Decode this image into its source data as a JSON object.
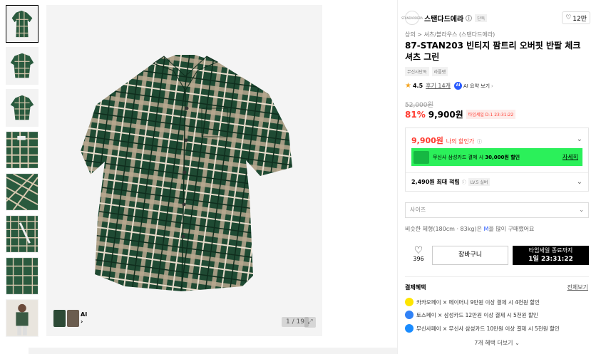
{
  "thumbnails": {
    "count": 8,
    "active_index": 0
  },
  "main_image": {
    "counter": "1 / 19",
    "ai_chip_label": "AI",
    "ai_chip_chevron": "›"
  },
  "brand": {
    "logo_text": "STANDARDERA",
    "name": "스탠다드에라",
    "tag": "단독",
    "likes": "12만"
  },
  "breadcrumb": "상의 > 셔츠/블라우스 (스탠다드에라)",
  "product": {
    "title": "87-STAN203 빈티지 팜트리 오버핏 반팔 체크 셔츠 그린",
    "tags": [
      "무신사단독",
      "라플렛"
    ],
    "rating": "4.5",
    "review_link": "후기 14개",
    "ai_summary": "AI 요약 보기"
  },
  "pricing": {
    "original": "52,000원",
    "discount": "81%",
    "price": "9,900원",
    "timesale": "타임세일 D-1 23:31:22"
  },
  "benefit_box": {
    "my_price": "9,900원",
    "my_price_label": "나의 할인가",
    "promo_text_pre": "무신사 삼성카드 결제 시 ",
    "promo_text_bold": "30,000원 할인",
    "promo_detail": "자세히",
    "points": "2,490원 최대 적립",
    "level": "LV.5 실버"
  },
  "size": {
    "placeholder": "사이즈",
    "note_pre": "비슷한 체형(180cm · 83kg)은 ",
    "note_size": "M",
    "note_post": "을 많이 구매했어요"
  },
  "actions": {
    "like_count": "396",
    "cart": "장바구니",
    "buy_line1": "타임세일 종료까지",
    "buy_line2": "1일 23:31:22"
  },
  "payment": {
    "title": "결제혜택",
    "view_all": "전체보기",
    "items": [
      {
        "text": "카카오페이 × 페이머니 9만원 이상 결제 시 4천원 할인",
        "color": "#fee500"
      },
      {
        "text": "토스페이 × 삼성카드 12만원 이상 결제 시 5천원 할인",
        "color": "#3182f6"
      },
      {
        "text": "무신사페이 × 무신사 삼성카드 10만원 이상 결제 시 5천원 할인",
        "color": "#1a8cff"
      }
    ],
    "more": "7개 혜택 더보기 ⌄"
  },
  "colors": {
    "accent_red": "#ff3b30",
    "promo_green": "#2bf05a",
    "shirt_green": "#1f4a33"
  }
}
